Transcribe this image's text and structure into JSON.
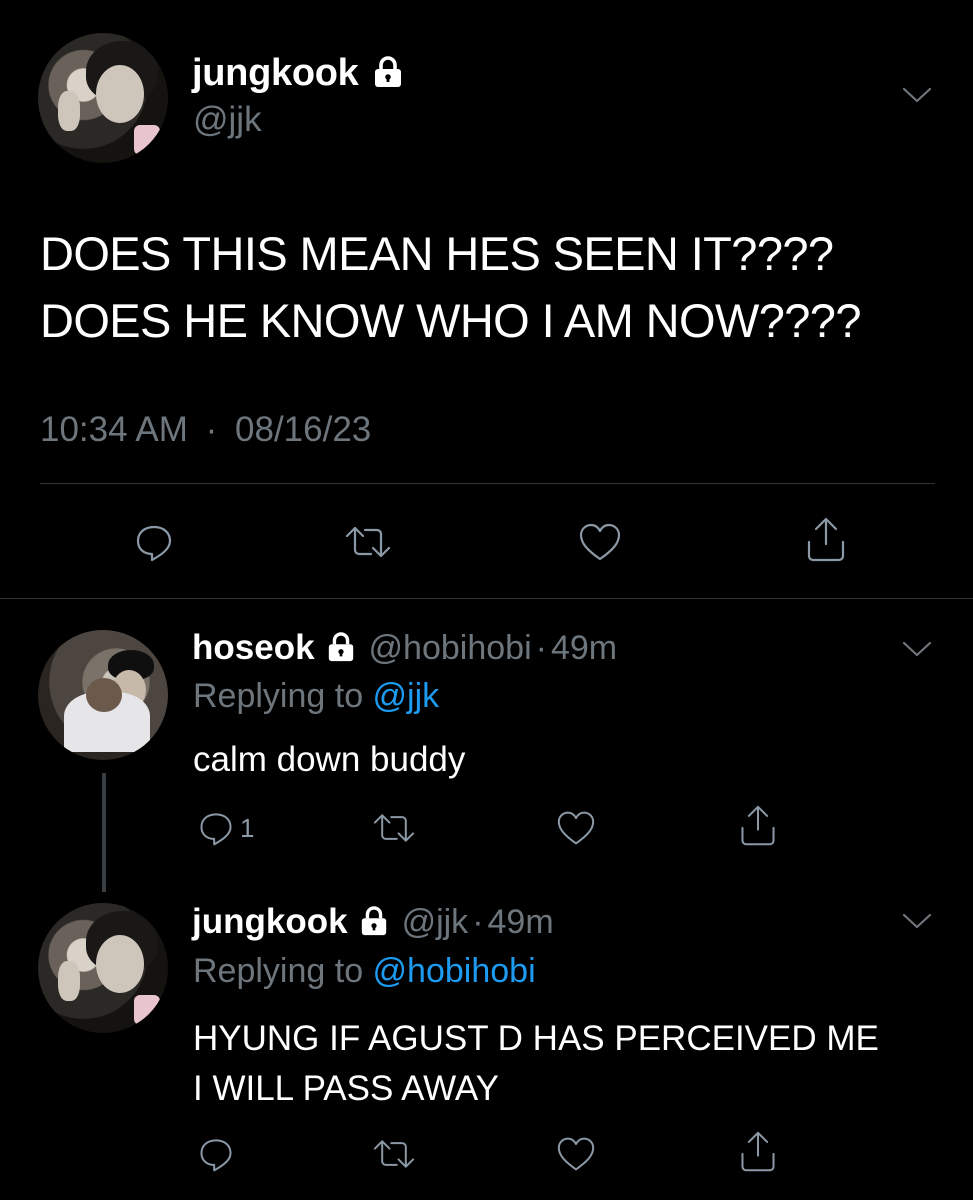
{
  "main_tweet": {
    "display_name": "jungkook",
    "handle": "@jjk",
    "text_line1": "DOES THIS MEAN HES SEEN IT????",
    "text_line2": "DOES HE KNOW WHO I AM NOW????",
    "time": "10:34 AM",
    "separator": "·",
    "date": "08/16/23"
  },
  "reply1": {
    "display_name": "hoseok",
    "handle": "@hobihobi",
    "separator": "·",
    "age": "49m",
    "replying_prefix": "Replying to ",
    "replying_to": "@jjk",
    "text": "calm down buddy",
    "reply_count": "1"
  },
  "reply2": {
    "display_name": "jungkook",
    "handle": "@jjk",
    "separator": "·",
    "age": "49m",
    "replying_prefix": "Replying to ",
    "replying_to": "@hobihobi",
    "text_line1": "HYUNG IF AGUST D HAS PERCEIVED ME",
    "text_line2": "I WILL PASS AWAY"
  },
  "icons": {
    "reply": "reply-icon",
    "retweet": "retweet-icon",
    "like": "heart-icon",
    "share": "share-icon",
    "lock": "lock-icon",
    "chevron": "chevron-down-icon"
  },
  "colors": {
    "background": "#000000",
    "text": "#ffffff",
    "muted": "#6e767d",
    "link": "#1d9bf0",
    "divider": "#2f3336"
  }
}
